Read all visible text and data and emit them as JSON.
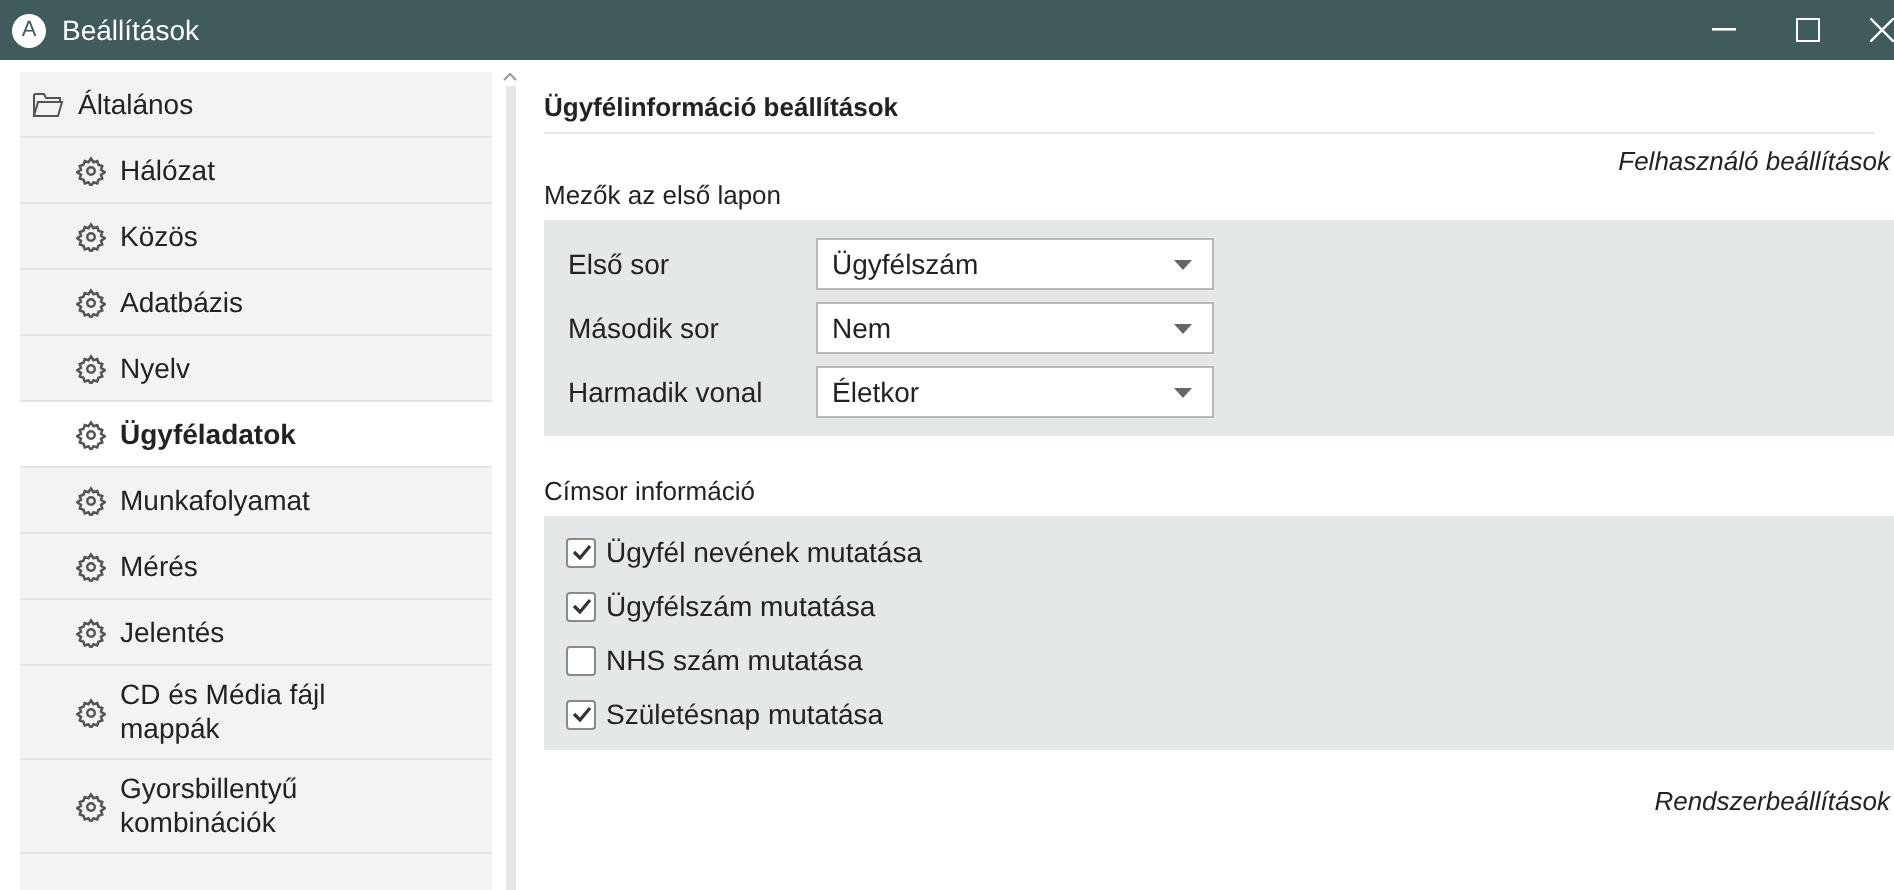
{
  "window": {
    "badge": "A",
    "title": "Beállítások"
  },
  "sidebar": {
    "root": {
      "label": "Általános",
      "expanded": true,
      "children": [
        {
          "label": "Hálózat",
          "selected": false
        },
        {
          "label": "Közös",
          "selected": false
        },
        {
          "label": "Adatbázis",
          "selected": false
        },
        {
          "label": "Nyelv",
          "selected": false
        },
        {
          "label": "Ügyféladatok",
          "selected": true
        },
        {
          "label": "Munkafolyamat",
          "selected": false
        },
        {
          "label": "Mérés",
          "selected": false
        },
        {
          "label": "Jelentés",
          "selected": false
        },
        {
          "label": "CD és Média fájl mappák",
          "selected": false
        },
        {
          "label": "Gyorsbillentyű kombinációk",
          "selected": false
        }
      ]
    }
  },
  "content": {
    "title": "Ügyfélinformáció beállítások",
    "scope_top": "Felhasználó beállítások",
    "fields_section": {
      "heading": "Mezők az első lapon",
      "rows": [
        {
          "label": "Első sor",
          "value": "Ügyfélszám"
        },
        {
          "label": "Második sor",
          "value": "Nem"
        },
        {
          "label": "Harmadik vonal",
          "value": "Életkor"
        }
      ]
    },
    "header_section": {
      "heading": "Címsor információ",
      "options": [
        {
          "label": "Ügyfél nevének mutatása",
          "checked": true
        },
        {
          "label": "Ügyfélszám mutatása",
          "checked": true
        },
        {
          "label": "NHS szám mutatása",
          "checked": false
        },
        {
          "label": "Születésnap mutatása",
          "checked": true
        }
      ]
    },
    "scope_bottom": "Rendszerbeállítások"
  }
}
